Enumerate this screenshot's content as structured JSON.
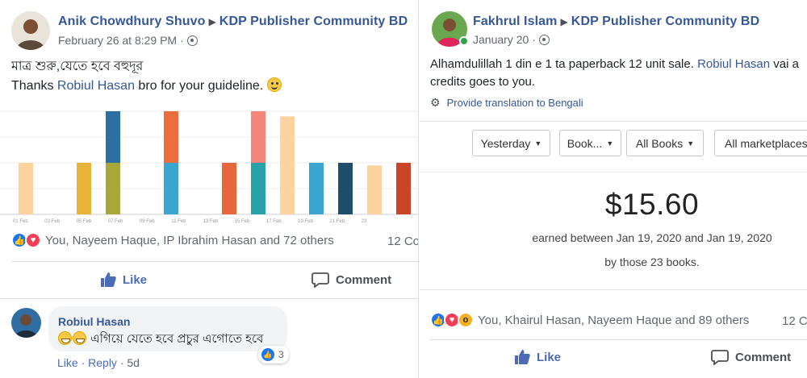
{
  "left_post": {
    "author": "Anik Chowdhury Shuvo",
    "group": "KDP Publisher Community BD",
    "timestamp": "February 26 at 8:29 PM",
    "dot": "·",
    "text_line1": "মাত্র শুরু,যেতে হবে বহুদূর",
    "text_line2_prefix": "Thanks ",
    "text_line2_link": "Robiul Hasan",
    "text_line2_suffix": " bro for your guideline.",
    "reactions_text": "You, Nayeem Haque, IP Ibrahim Hasan and 72 others",
    "comments_count": "12 Co",
    "like_label": "Like",
    "comment_label": "Comment",
    "chart_data": {
      "type": "bar",
      "categories": [
        "01 Feb",
        "03 Feb",
        "05 Feb",
        "07 Feb",
        "09 Feb",
        "11 Feb",
        "13 Feb",
        "15 Feb",
        "17 Feb",
        "19 Feb",
        "21 Feb",
        "23"
      ],
      "tick_labels": [
        "01 Feb",
        "03 Feb",
        "05 Feb",
        "07 Feb",
        "09 Feb",
        "11 Feb",
        "13 Feb",
        "15 Feb",
        "17 Feb",
        "19 Feb",
        "21 Feb",
        "23"
      ],
      "bars": [
        {
          "x": 0.5,
          "segments": [
            {
              "value": 1,
              "color": "#fdd49e"
            }
          ]
        },
        {
          "x": 2.5,
          "segments": [
            {
              "value": 1,
              "color": "#e8b339"
            }
          ]
        },
        {
          "x": 3.5,
          "segments": [
            {
              "value": 1,
              "color": "#a8a83a"
            },
            {
              "value": 1,
              "color": "#2e6fa3"
            }
          ]
        },
        {
          "x": 5.5,
          "segments": [
            {
              "value": 1,
              "color": "#3aa6d0"
            },
            {
              "value": 1,
              "color": "#ec6e3f"
            }
          ]
        },
        {
          "x": 7.5,
          "segments": [
            {
              "value": 1,
              "color": "#e8663d"
            }
          ]
        },
        {
          "x": 8.5,
          "segments": [
            {
              "value": 1,
              "color": "#2aa3a8"
            },
            {
              "value": 1,
              "color": "#f3857a"
            }
          ]
        },
        {
          "x": 9.5,
          "segments": [
            {
              "value": 1.9,
              "color": "#fdd49e"
            }
          ]
        },
        {
          "x": 10.5,
          "segments": [
            {
              "value": 1,
              "color": "#3aa6d0"
            }
          ]
        },
        {
          "x": 11.5,
          "segments": [
            {
              "value": 1,
              "color": "#1f4e6b"
            }
          ]
        },
        {
          "x": 12.5,
          "segments": [
            {
              "value": 0.95,
              "color": "#fdd49e"
            }
          ]
        },
        {
          "x": 13.5,
          "segments": [
            {
              "value": 1,
              "color": "#c9452a"
            }
          ]
        }
      ],
      "ylim": [
        0,
        2
      ],
      "grid": true
    }
  },
  "left_comment": {
    "author": "Robiul Hasan",
    "text": "এগিয়ে যেতে হবে প্রচুর এগোতে হবে",
    "reaction_count": "3",
    "like": "Like",
    "reply": "Reply",
    "age": "5d",
    "dot": "·"
  },
  "right_post": {
    "author": "Fakhrul Islam",
    "group": "KDP Publisher Community BD",
    "timestamp": "January 20",
    "dot": "·",
    "text_line1_prefix": "Alhamdulillah 1 din e 1 ta paperback 12 unit sale. ",
    "text_line1_link": "Robiul Hasan",
    "text_line1_suffix": " vai a",
    "text_line2": "credits goes to you.",
    "translate_label": "Provide translation to Bengali",
    "kdp": {
      "filter_date": "Yesterday",
      "filter_book": "Book...",
      "filter_books": "All Books",
      "filter_markets": "All marketplaces",
      "amount": "$15.60",
      "earned_line": "earned between Jan 19, 2020 and Jan 19, 2020",
      "books_line": "by those 23 books."
    },
    "reactions_text": "You, Khairul Hasan, Nayeem Haque and 89 others",
    "comments_count": "12 Co",
    "like_label": "Like",
    "comment_label": "Comment"
  },
  "colors": {
    "link": "#365899",
    "like_blue": "#1877f2",
    "love_red": "#f33e58",
    "online_green": "#31a24c"
  },
  "icons": {
    "like": "thumbs-up-icon",
    "love": "heart-icon",
    "wow": "wow-icon",
    "comment": "speech-bubble-icon",
    "globe": "globe-icon",
    "gear": "gear-icon"
  }
}
